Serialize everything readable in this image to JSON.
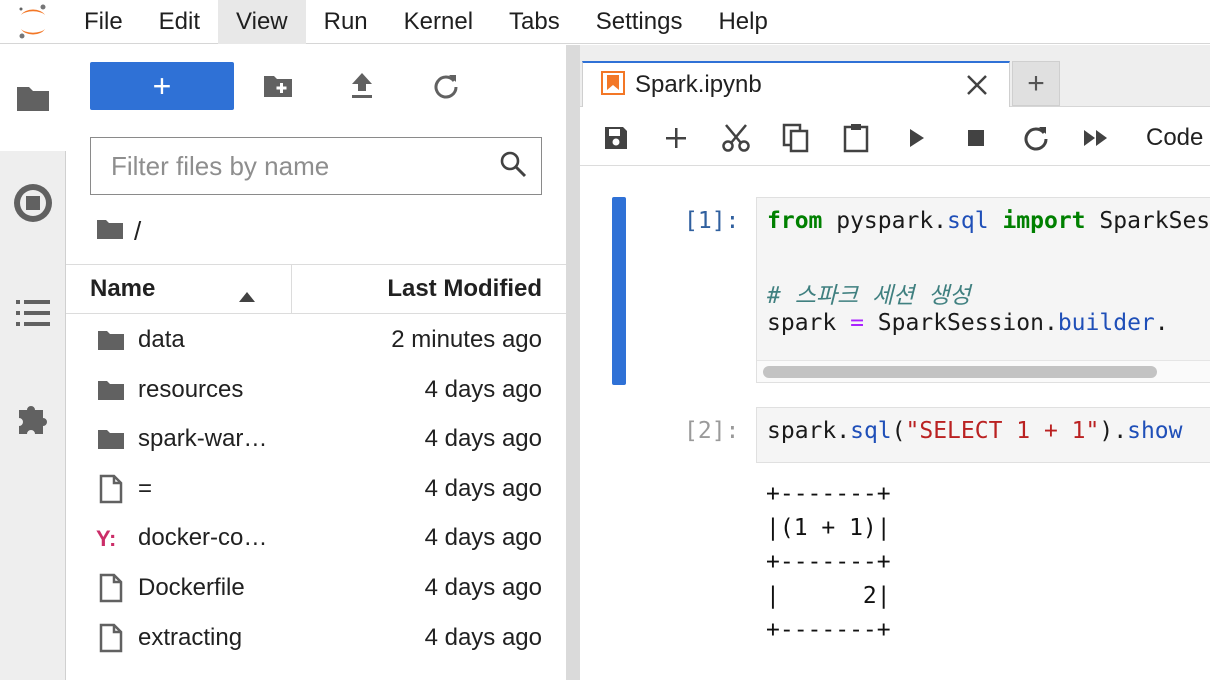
{
  "menubar": {
    "items": [
      "File",
      "Edit",
      "View",
      "Run",
      "Kernel",
      "Tabs",
      "Settings",
      "Help"
    ],
    "active": "View"
  },
  "filebrowser": {
    "new_button_label": "+",
    "filter_placeholder": "Filter files by name",
    "breadcrumb": "/",
    "columns": {
      "name": "Name",
      "last_modified": "Last Modified"
    },
    "files": [
      {
        "name": "data",
        "modified": "2 minutes ago",
        "icon": "folder-icon"
      },
      {
        "name": "resources",
        "modified": "4 days ago",
        "icon": "folder-icon"
      },
      {
        "name": "spark-war…",
        "modified": "4 days ago",
        "icon": "folder-icon"
      },
      {
        "name": "=",
        "modified": "4 days ago",
        "icon": "file-icon"
      },
      {
        "name": "docker-co…",
        "modified": "4 days ago",
        "icon": "yaml-icon"
      },
      {
        "name": "Dockerfile",
        "modified": "4 days ago",
        "icon": "file-icon"
      },
      {
        "name": "extracting",
        "modified": "4 days ago",
        "icon": "file-icon"
      }
    ]
  },
  "tabs": {
    "active_label": "Spark.ipynb",
    "add_label": "+"
  },
  "notebook": {
    "cell_type": "Code",
    "cells": [
      {
        "prompt": "[1]:",
        "lines": [
          [
            {
              "t": "from",
              "c": "kw"
            },
            {
              "t": " pyspark",
              "c": ""
            },
            {
              "t": ".",
              "c": ""
            },
            {
              "t": "sql",
              "c": "attr"
            },
            {
              "t": " ",
              "c": ""
            },
            {
              "t": "import",
              "c": "kw"
            },
            {
              "t": " SparkSession",
              "c": ""
            }
          ],
          [],
          [
            {
              "t": "# 스파크 세션 생성",
              "c": "cm"
            }
          ],
          [
            {
              "t": "spark ",
              "c": ""
            },
            {
              "t": "=",
              "c": "op"
            },
            {
              "t": " SparkSession",
              "c": ""
            },
            {
              "t": ".",
              "c": ""
            },
            {
              "t": "builder",
              "c": "attr"
            },
            {
              "t": ".",
              "c": ""
            }
          ]
        ]
      },
      {
        "prompt": "[2]:",
        "lines": [
          [
            {
              "t": "spark",
              "c": ""
            },
            {
              "t": ".",
              "c": ""
            },
            {
              "t": "sql",
              "c": "attr"
            },
            {
              "t": "(",
              "c": ""
            },
            {
              "t": "\"SELECT 1 + 1\"",
              "c": "str"
            },
            {
              "t": ")",
              "c": ""
            },
            {
              "t": ".",
              "c": ""
            },
            {
              "t": "show",
              "c": "attr"
            }
          ]
        ],
        "output": "+-------+\n|(1 + 1)|\n+-------+\n|      2|\n+-------+"
      }
    ]
  },
  "colors": {
    "accent": "#2f71d6",
    "jupyter_orange": "#f37726",
    "yaml_icon": "#cb2d68"
  }
}
